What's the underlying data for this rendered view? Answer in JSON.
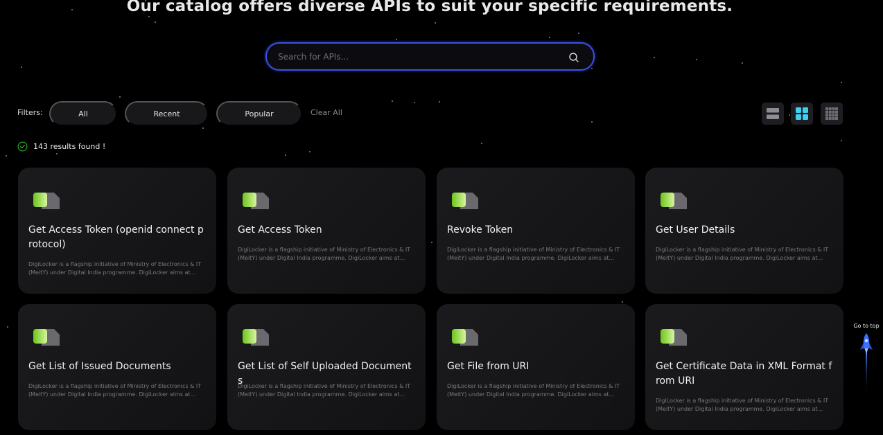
{
  "headline": "Our catalog offers diverse APIs to suit your specific requirements.",
  "search": {
    "placeholder": "Search for APIs...",
    "icon": "search-icon"
  },
  "filters": {
    "label": "Filters:",
    "options": [
      "All",
      "Recent",
      "Popular"
    ],
    "clear_label": "Clear All"
  },
  "view_modes": [
    {
      "name": "list-view",
      "icon": "rows-icon",
      "active": false
    },
    {
      "name": "grid-view",
      "icon": "grid-2x2-icon",
      "active": true
    },
    {
      "name": "compact-grid-view",
      "icon": "grid-dots-icon",
      "active": false
    }
  ],
  "results": {
    "text": "143 results found !"
  },
  "cards": [
    {
      "title": "Get Access Token (openid connect protocol)",
      "description": "DigiLocker is a flagship initiative of Ministry of Electronics & IT (MeitY) under Digital India programme. DigiLocker aims at..."
    },
    {
      "title": "Get Access Token",
      "description": "DigiLocker is a flagship initiative of Ministry of Electronics & IT (MeitY) under Digital India programme. DigiLocker aims at..."
    },
    {
      "title": "Revoke Token",
      "description": "DigiLocker is a flagship initiative of Ministry of Electronics & IT (MeitY) under Digital India programme. DigiLocker aims at..."
    },
    {
      "title": "Get User Details",
      "description": "DigiLocker is a flagship initiative of Ministry of Electronics & IT (MeitY) under Digital India programme. DigiLocker aims at..."
    },
    {
      "title": "Get List of Issued Documents",
      "description": "DigiLocker is a flagship initiative of Ministry of Electronics & IT (MeitY) under Digital India programme. DigiLocker aims at..."
    },
    {
      "title": "Get List of Self Uploaded Documents",
      "description": "DigiLocker is a flagship initiative of Ministry of Electronics & IT (MeitY) under Digital India programme. DigiLocker aims at..."
    },
    {
      "title": "Get File from URI",
      "description": "DigiLocker is a flagship initiative of Ministry of Electronics & IT (MeitY) under Digital India programme. DigiLocker aims at..."
    },
    {
      "title": "Get Certificate Data in XML Format from URI",
      "description": "DigiLocker is a flagship initiative of Ministry of Electronics & IT (MeitY) under Digital India programme. DigiLocker aims at..."
    }
  ],
  "go_top": {
    "label": "Go to top",
    "icon": "rocket-icon"
  },
  "colors": {
    "accent": "#3b4fe0",
    "active_view": "#3fd0ef",
    "card_icon_green": "#7ed321",
    "success": "#2eb82e"
  }
}
